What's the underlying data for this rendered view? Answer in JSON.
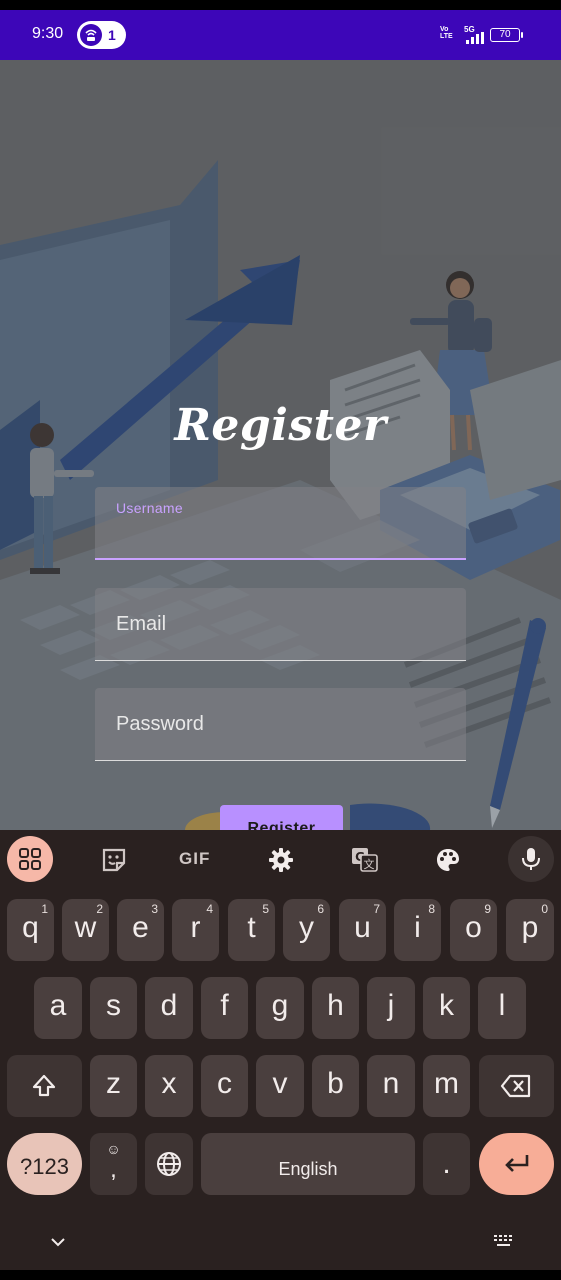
{
  "status_bar": {
    "time": "9:30",
    "hotspot_count": "1",
    "network_label": "5G",
    "volte_label": "Vo LTE",
    "battery": "70",
    "background_color": "#3d06b8"
  },
  "register_form": {
    "title": "Register",
    "username_label": "Username",
    "email_placeholder": "Email",
    "password_placeholder": "Password",
    "register_button": "Register",
    "accent_color": "#c9a2ff"
  },
  "keyboard": {
    "toolbar": {
      "apps": "apps-grid-icon",
      "sticker": "sticker-icon",
      "gif": "GIF",
      "settings": "gear-icon",
      "translate": "translate-icon",
      "theme": "palette-icon",
      "voice": "mic-icon"
    },
    "row1": [
      {
        "key": "q",
        "hint": "1"
      },
      {
        "key": "w",
        "hint": "2"
      },
      {
        "key": "e",
        "hint": "3"
      },
      {
        "key": "r",
        "hint": "4"
      },
      {
        "key": "t",
        "hint": "5"
      },
      {
        "key": "y",
        "hint": "6"
      },
      {
        "key": "u",
        "hint": "7"
      },
      {
        "key": "i",
        "hint": "8"
      },
      {
        "key": "o",
        "hint": "9"
      },
      {
        "key": "p",
        "hint": "0"
      }
    ],
    "row2": [
      "a",
      "s",
      "d",
      "f",
      "g",
      "h",
      "j",
      "k",
      "l"
    ],
    "row3": [
      "z",
      "x",
      "c",
      "v",
      "b",
      "n",
      "m"
    ],
    "symbols_key": "?123",
    "comma_key": ",",
    "space_label": "English",
    "period_key": ".",
    "emoji_hint": "☺"
  }
}
